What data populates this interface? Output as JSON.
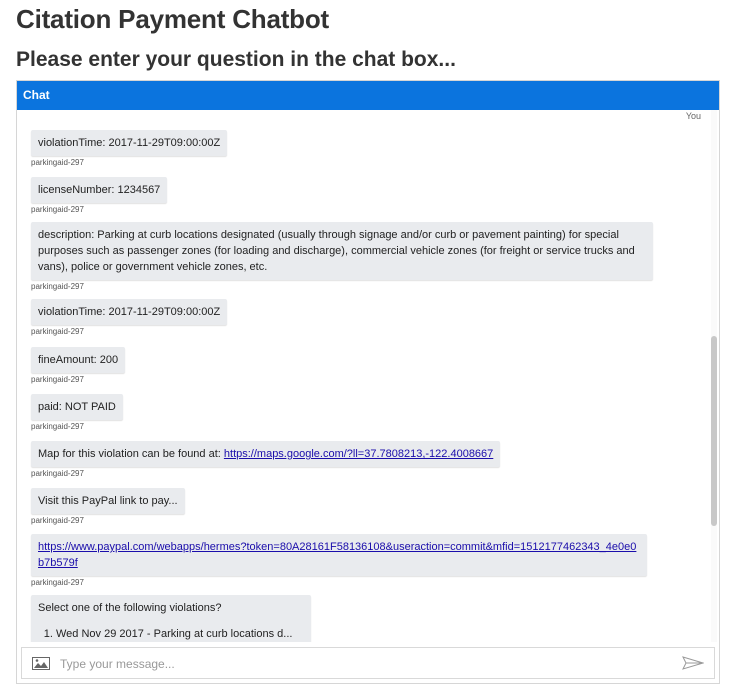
{
  "page": {
    "title": "Citation Payment Chatbot",
    "subtitle": "Please enter your question in the chat box..."
  },
  "chat": {
    "header": "Chat",
    "you_label": "You",
    "messages": [
      {
        "text": "violationTime: 2017-11-29T09:00:00Z",
        "sender": "parkingaid-297"
      },
      {
        "text": "licenseNumber: 1234567",
        "sender": "parkingaid-297"
      },
      {
        "text": "description: Parking at curb locations designated (usually through signage and/or curb or pavement painting) for special purposes such as passenger zones (for loading and discharge), commercial vehicle zones (for freight or service trucks and vans), police or government vehicle zones, etc.",
        "sender": "parkingaid-297"
      },
      {
        "text": "violationTime: 2017-11-29T09:00:00Z",
        "sender": "parkingaid-297"
      },
      {
        "text": "fineAmount: 200",
        "sender": "parkingaid-297"
      },
      {
        "text": "paid: NOT PAID",
        "sender": "parkingaid-297"
      },
      {
        "text": "Map for this violation can be found at: ",
        "link": "https://maps.google.com/?ll=37.7808213,-122.4008667",
        "sender": "parkingaid-297"
      },
      {
        "text": "Visit this PayPal link to pay...",
        "sender": "parkingaid-297"
      },
      {
        "link": "https://www.paypal.com/webapps/hermes?token=80A28161F58136108&useraction=commit&mfid=1512177462343_4e0e0b7b579f",
        "sender": "parkingaid-297"
      },
      {
        "text": "Select one of the following violations?",
        "options": [
          "Wed Nov 29 2017 - Parking at curb locations d..."
        ]
      }
    ],
    "input": {
      "placeholder": "Type your message..."
    }
  }
}
